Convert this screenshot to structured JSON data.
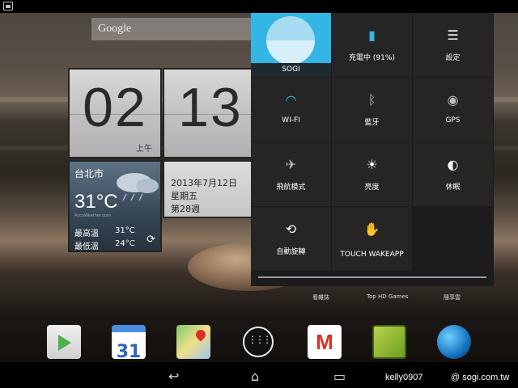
{
  "search": {
    "label": "Google"
  },
  "clock": {
    "hour": "02",
    "minute": "13",
    "ampm": "上午"
  },
  "weather": {
    "city": "台北市",
    "temp": "31°C",
    "source": "AccuWeather.com",
    "high_label": "最高溫",
    "high_value": "31°C",
    "low_label": "最低溫",
    "low_value": "24°C"
  },
  "date": {
    "full": "2013年7月12日",
    "weekday": "星期五",
    "week": "第28週"
  },
  "quick_settings": {
    "user": "SOGI",
    "battery": "充電中 (91%)",
    "settings": "設定",
    "wifi": "WI-FI",
    "bluetooth": "藍牙",
    "gps": "GPS",
    "airplane": "飛航模式",
    "brightness": "亮度",
    "sleep": "休眠",
    "rotate": "自動旋轉",
    "touch_wakeapp": "TOUCH WAKEAPP"
  },
  "home_labels": {
    "magazine": "看雜誌",
    "games": "Top HD Games",
    "share": "隨享雲"
  },
  "dock": {
    "calendar_day": "31"
  },
  "watermark": {
    "user": "kelly0907",
    "site": "@ sogi.com.tw"
  },
  "colors": {
    "accent": "#33b5e5",
    "panel": "#1c1c1c",
    "tile": "#252525"
  }
}
